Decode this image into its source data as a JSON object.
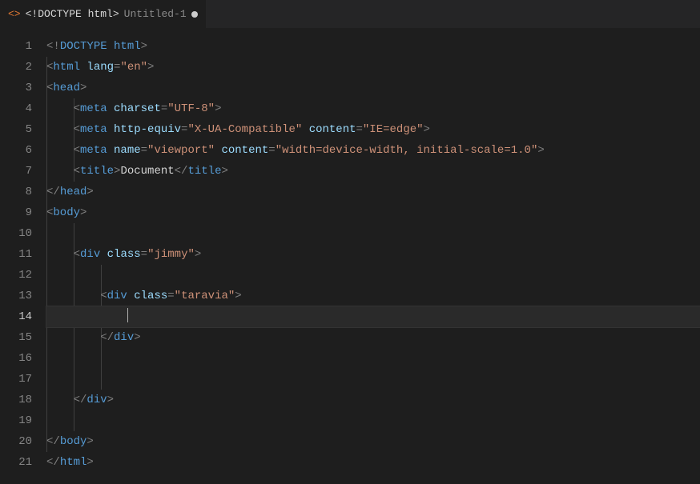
{
  "tab": {
    "icon_symbol": "<>",
    "crumb1": "<!DOCTYPE html>",
    "crumb2": "Untitled-1",
    "dirty": true
  },
  "editor": {
    "active_line": 14,
    "line_count": 21,
    "tokens": {
      "doctype_excl": "!",
      "doctype_kw": "DOCTYPE",
      "doctype_root": "html",
      "tag_html": "html",
      "attr_lang": "lang",
      "val_en": "\"en\"",
      "tag_head": "head",
      "tag_meta": "meta",
      "attr_charset": "charset",
      "val_utf8": "\"UTF-8\"",
      "attr_httpequiv": "http-equiv",
      "val_xua": "\"X-UA-Compatible\"",
      "attr_content": "content",
      "val_ieedge": "\"IE=edge\"",
      "attr_name": "name",
      "val_viewport": "\"viewport\"",
      "val_vpcontent": "\"width=device-width, initial-scale=1.0\"",
      "tag_title": "title",
      "txt_document": "Document",
      "tag_body": "body",
      "tag_div": "div",
      "attr_class": "class",
      "val_jimmy": "\"jimmy\"",
      "val_taravia": "\"taravia\""
    }
  }
}
